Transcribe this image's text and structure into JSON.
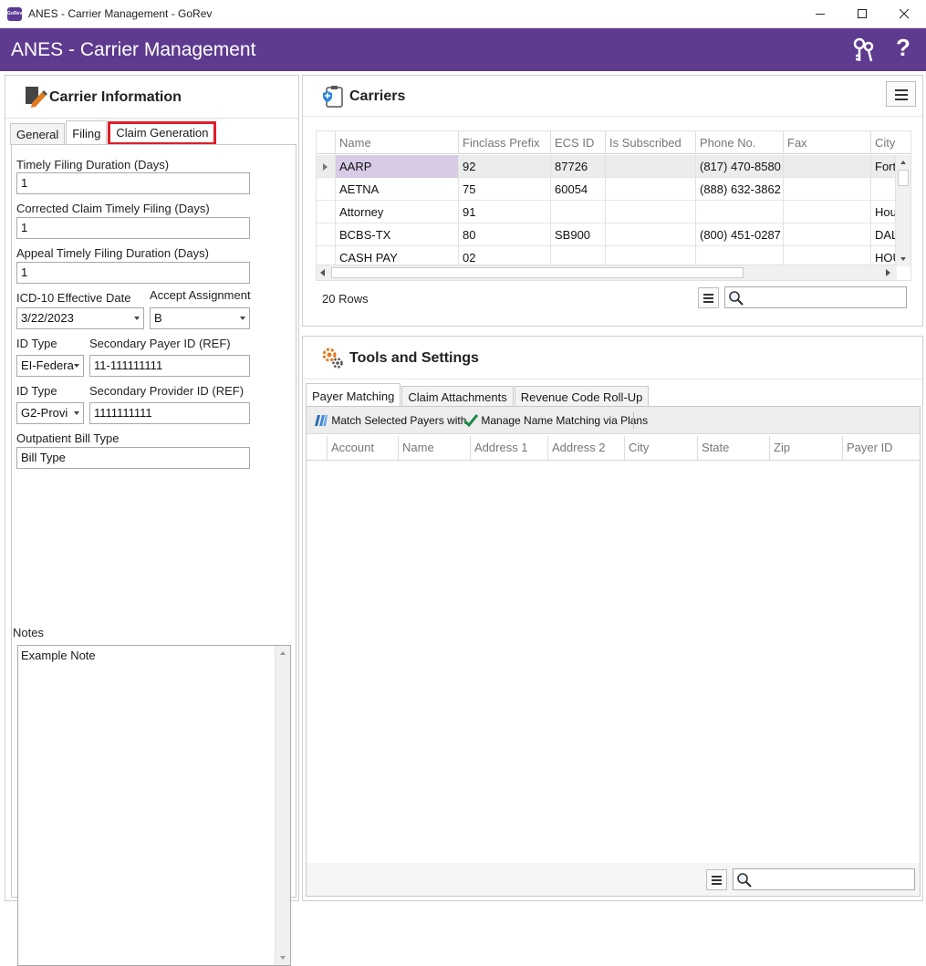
{
  "window": {
    "title": "ANES - Carrier Management - GoRev",
    "app_icon_text": "GoRev"
  },
  "header": {
    "title": "ANES - Carrier Management",
    "help_label": "?"
  },
  "carrier_info": {
    "title": "Carrier Information",
    "tabs": [
      {
        "label": "General"
      },
      {
        "label": "Filing"
      },
      {
        "label": "Claim Generation"
      }
    ],
    "fields": {
      "timely_filing_label": "Timely Filing Duration (Days)",
      "timely_filing_value": "1",
      "corrected_label": "Corrected Claim Timely Filing (Days)",
      "corrected_value": "1",
      "appeal_label": "Appeal Timely Filing Duration (Days)",
      "appeal_value": "1",
      "icd_label": "ICD-10 Effective Date",
      "icd_value": "3/22/2023",
      "accept_label": "Accept Assignment",
      "accept_value": "B",
      "id_type1_label": "ID Type",
      "id_type1_value": "EI-Federa",
      "sec_payer_label": "Secondary Payer ID (REF)",
      "sec_payer_value": "11-111111111",
      "id_type2_label": "ID Type",
      "id_type2_value": "G2-Provi",
      "sec_provider_label": "Secondary Provider ID (REF)",
      "sec_provider_value": "1111111111",
      "outpatient_label": "Outpatient Bill Type",
      "outpatient_value": "Bill Type"
    },
    "notes_label": "Notes",
    "notes_value": "Example Note"
  },
  "carriers": {
    "title": "Carriers",
    "columns": [
      "Name",
      "Finclass Prefix",
      "ECS ID",
      "Is Subscribed",
      "Phone No.",
      "Fax",
      "City"
    ],
    "rows": [
      [
        "AARP",
        "92",
        "87726",
        "",
        "(817) 470-8580",
        "",
        "Fort"
      ],
      [
        "AETNA",
        "75",
        "60054",
        "",
        "(888) 632-3862",
        "",
        ""
      ],
      [
        "Attorney",
        "91",
        "",
        "",
        "",
        "",
        "Hou"
      ],
      [
        "BCBS-TX",
        "80",
        "SB900",
        "",
        "(800) 451-0287",
        "",
        "DAL"
      ],
      [
        "CASH PAY",
        "02",
        "",
        "",
        "",
        "",
        "HOU"
      ]
    ],
    "row_count": "20 Rows"
  },
  "tools": {
    "title": "Tools and Settings",
    "tabs": [
      {
        "label": "Payer Matching"
      },
      {
        "label": "Claim Attachments"
      },
      {
        "label": "Revenue Code Roll-Up"
      }
    ],
    "toolbar": {
      "match_label": "Match Selected Payers with",
      "manage_label": "Manage Name Matching via Plans"
    },
    "columns": [
      "Account",
      "Name",
      "Address 1",
      "Address 2",
      "City",
      "State",
      "Zip",
      "Payer ID"
    ]
  },
  "colors": {
    "brand": "#5e3b8e",
    "highlight": "#e01d27",
    "selected_cell": "#d7cbe6"
  }
}
